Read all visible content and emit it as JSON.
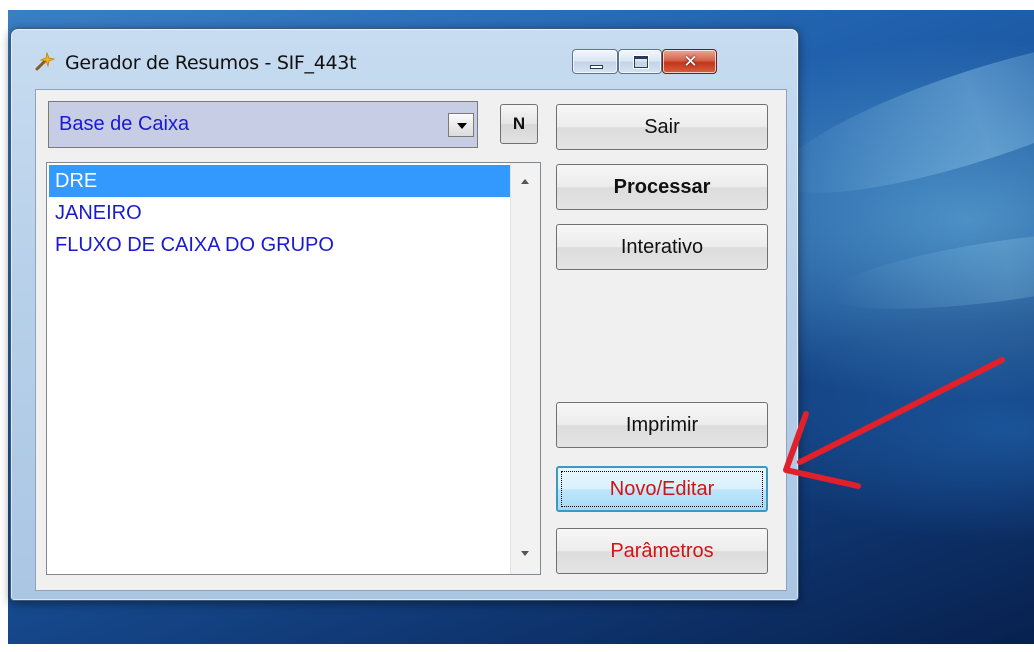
{
  "window": {
    "title": "Gerador de Resumos - SIF_443t",
    "icon": "app-wand-icon",
    "caption_buttons": [
      "minimize-icon",
      "maximize-icon",
      "close-icon"
    ]
  },
  "combo": {
    "selected": "Base de Caixa"
  },
  "n_button": {
    "label": "N"
  },
  "list": {
    "items": [
      {
        "label": "DRE",
        "selected": true
      },
      {
        "label": "JANEIRO",
        "selected": false
      },
      {
        "label": "FLUXO DE CAIXA DO GRUPO",
        "selected": false
      }
    ]
  },
  "buttons": {
    "sair": "Sair",
    "processar": "Processar",
    "interativo": "Interativo",
    "imprimir": "Imprimir",
    "novo_editar": "Novo/Editar",
    "parametros": "Parâmetros"
  },
  "colors": {
    "list_text": "#1a1ad0",
    "selection": "#3399ff",
    "red_label": "#d01414",
    "annotation_arrow": "#e0202a"
  },
  "annotation": {
    "icon": "red-arrow-icon",
    "points_to": "novo-editar-button"
  }
}
